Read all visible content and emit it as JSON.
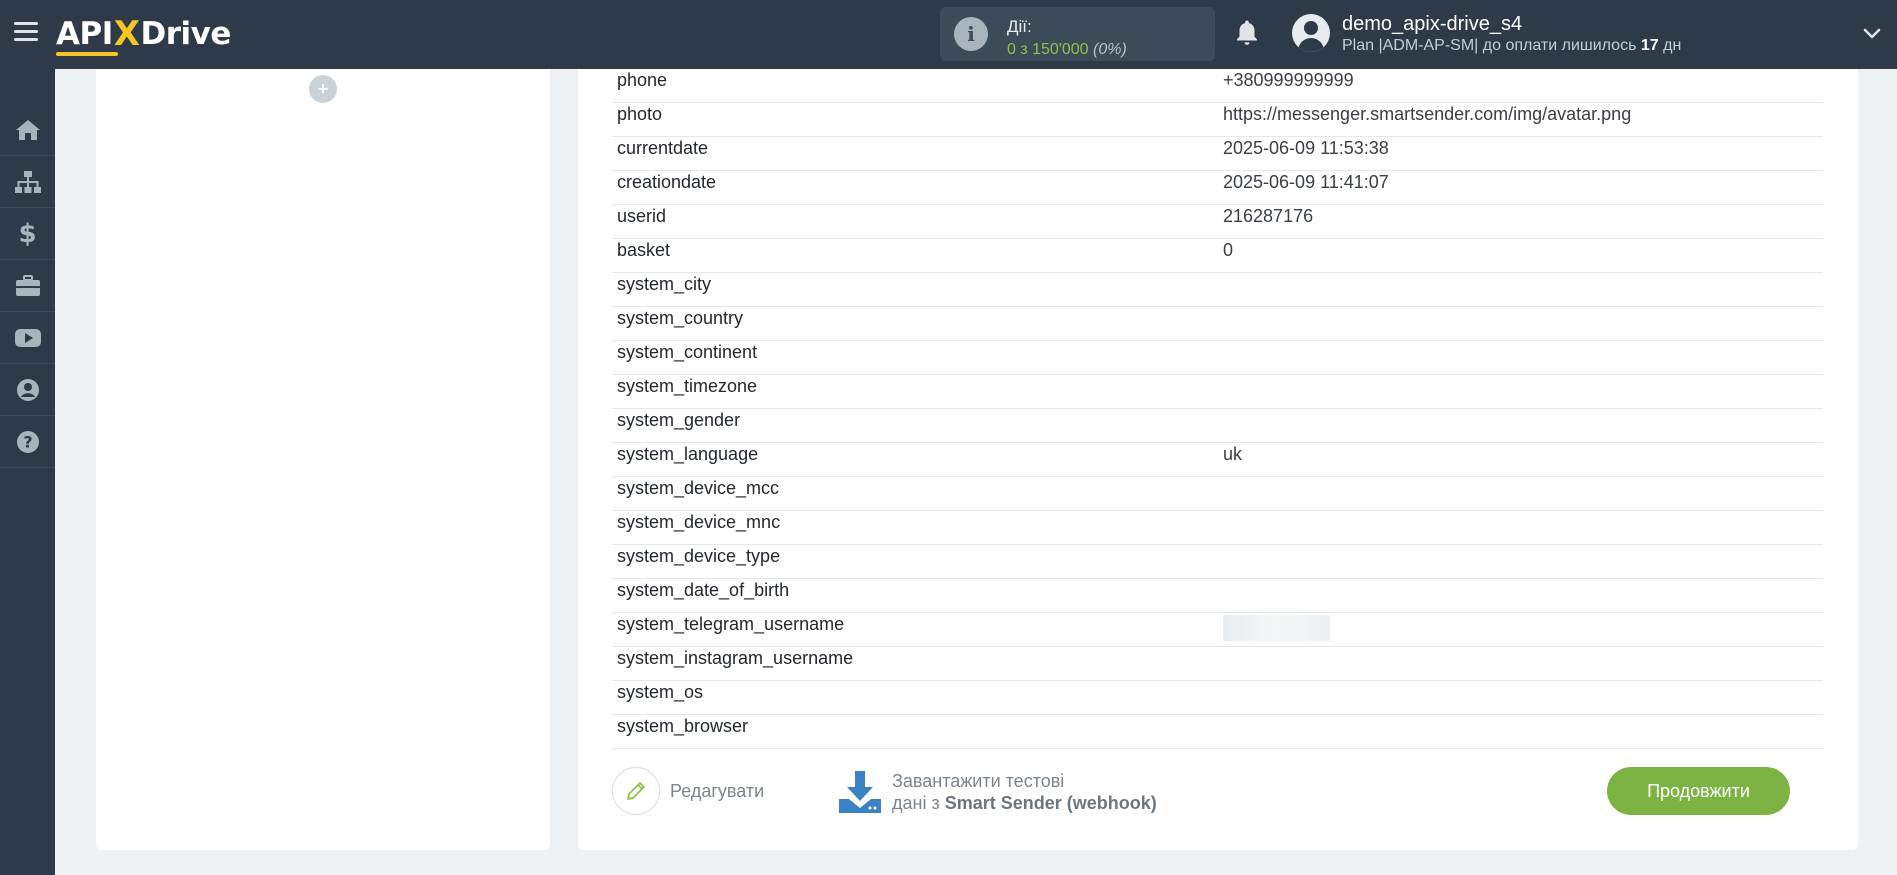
{
  "header": {
    "logo_left": "API",
    "logo_x": "X",
    "logo_right": "Drive",
    "actions_label": "Дії:",
    "actions_count": "0 з 150'000",
    "actions_pct": "(0%)",
    "username": "demo_apix-drive_s4",
    "plan_prefix": "Plan |ADM-AP-SM| до оплати лишилось ",
    "plan_days": "17",
    "plan_suffix": " дн"
  },
  "sidebar": {
    "items": [
      "home-icon",
      "sitemap-icon",
      "dollar-icon",
      "briefcase-icon",
      "youtube-icon",
      "user-icon",
      "help-icon"
    ]
  },
  "left_panel": {
    "add_label": "+"
  },
  "table": {
    "rows": [
      {
        "key": "phone",
        "value": "+380999999999"
      },
      {
        "key": "photo",
        "value": "https://messenger.smartsender.com/img/avatar.png"
      },
      {
        "key": "currentdate",
        "value": "2025-06-09 11:53:38"
      },
      {
        "key": "creationdate",
        "value": "2025-06-09 11:41:07"
      },
      {
        "key": "userid",
        "value": "216287176"
      },
      {
        "key": "basket",
        "value": "0"
      },
      {
        "key": "system_city",
        "value": ""
      },
      {
        "key": "system_country",
        "value": ""
      },
      {
        "key": "system_continent",
        "value": ""
      },
      {
        "key": "system_timezone",
        "value": ""
      },
      {
        "key": "system_gender",
        "value": ""
      },
      {
        "key": "system_language",
        "value": "uk"
      },
      {
        "key": "system_device_mcc",
        "value": ""
      },
      {
        "key": "system_device_mnc",
        "value": ""
      },
      {
        "key": "system_device_type",
        "value": ""
      },
      {
        "key": "system_date_of_birth",
        "value": ""
      },
      {
        "key": "system_telegram_username",
        "value": "",
        "blurred": true
      },
      {
        "key": "system_instagram_username",
        "value": ""
      },
      {
        "key": "system_os",
        "value": ""
      },
      {
        "key": "system_browser",
        "value": ""
      }
    ]
  },
  "footer": {
    "edit_label": "Редагувати",
    "download_line1": "Завантажити тестові",
    "download_line2_prefix": "дані з ",
    "download_line2_bold": "Smart Sender (webhook)",
    "continue_label": "Продовжити"
  },
  "colors": {
    "topbar": "#2e3a48",
    "accent_green": "#7cb342",
    "logo_yellow": "#f3c623",
    "download_blue": "#3b82c4"
  }
}
